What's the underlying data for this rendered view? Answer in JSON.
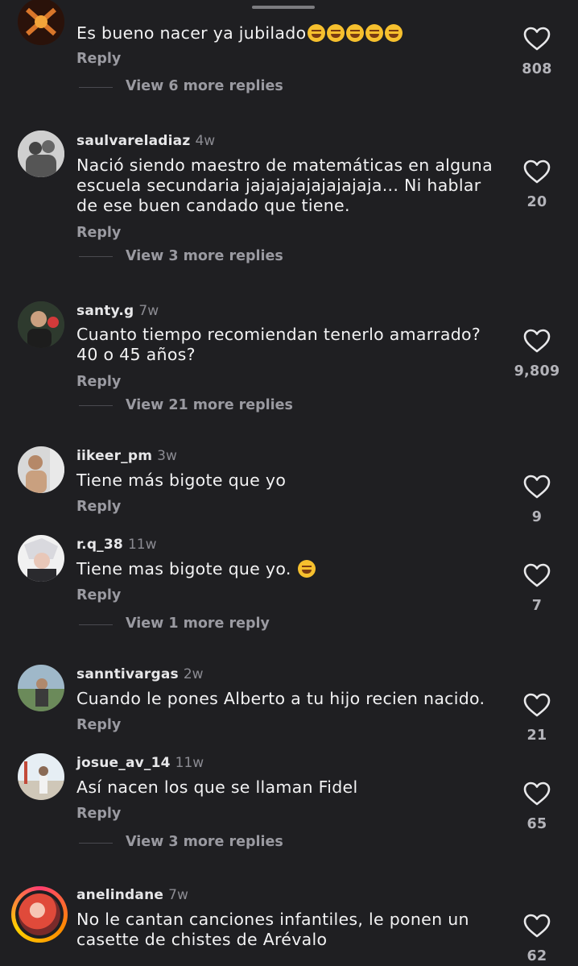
{
  "comments": [
    {
      "user": "",
      "time": "",
      "text": "Es bueno nacer ya jubilado",
      "emoji_count": 5,
      "reply_label": "Reply",
      "more_replies": "View 6 more replies",
      "likes": "808"
    },
    {
      "user": "saulvareladiaz",
      "time": "4w",
      "text": "Nació siendo maestro de matemáticas en alguna escuela secundaria jajajajajajajajaja... Ni hablar de ese buen candado que tiene.",
      "reply_label": "Reply",
      "more_replies": "View 3 more replies",
      "likes": "20"
    },
    {
      "user": "santy.g",
      "time": "7w",
      "text": "Cuanto tiempo recomiendan tenerlo amarrado? 40 o 45 años?",
      "reply_label": "Reply",
      "more_replies": "View 21 more replies",
      "likes": "9,809"
    },
    {
      "user": "iikeer_pm",
      "time": "3w",
      "text": "Tiene más bigote que yo",
      "reply_label": "Reply",
      "likes": "9"
    },
    {
      "user": "r.q_38",
      "time": "11w",
      "text": "Tiene mas bigote que yo.",
      "reply_label": "Reply",
      "more_replies": "View 1 more reply",
      "likes": "7"
    },
    {
      "user": "sanntivargas",
      "time": "2w",
      "text": "Cuando le pones Alberto a tu hijo recien nacido.",
      "reply_label": "Reply",
      "likes": "21"
    },
    {
      "user": "josue_av_14",
      "time": "11w",
      "text": "Así nacen los que se llaman Fidel",
      "reply_label": "Reply",
      "more_replies": "View 3 more replies",
      "likes": "65"
    },
    {
      "user": "anelindane",
      "time": "7w",
      "text": "No le cantan canciones infantiles, le ponen un casette de chistes de Arévalo",
      "likes": "62"
    }
  ],
  "icons": {
    "like": "heart-outline-icon",
    "emoji_laugh": "rolling-on-floor-laughing-emoji",
    "emoji_joy": "face-with-tears-of-joy-emoji"
  },
  "colors": {
    "background": "#1f1f22",
    "text": "#f2f2f3",
    "muted": "#9a9aa1"
  }
}
